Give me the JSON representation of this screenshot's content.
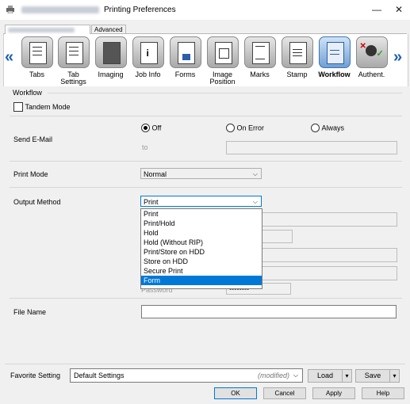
{
  "window": {
    "title": "Printing Preferences",
    "minimize_icon": "minimize-icon",
    "close_icon": "close-icon"
  },
  "main_tabs": [
    {
      "label": "",
      "active": true
    },
    {
      "label": "Advanced",
      "active": false
    }
  ],
  "toolbar": {
    "left_arrow": "«",
    "right_arrow": "»",
    "items": [
      {
        "label": "Tabs",
        "icon": "tabs-icon"
      },
      {
        "label": "Tab\nSettings",
        "icon": "tab-settings-icon"
      },
      {
        "label": "Imaging",
        "icon": "imaging-icon"
      },
      {
        "label": "Job Info",
        "icon": "job-info-icon"
      },
      {
        "label": "Forms",
        "icon": "forms-icon"
      },
      {
        "label": "Image\nPosition",
        "icon": "image-position-icon"
      },
      {
        "label": "Marks",
        "icon": "marks-icon"
      },
      {
        "label": "Stamp",
        "icon": "stamp-icon"
      },
      {
        "label": "Workflow",
        "icon": "workflow-icon",
        "active": true
      },
      {
        "label": "Authent.",
        "icon": "authentication-icon"
      }
    ]
  },
  "workflow": {
    "section_title": "Workflow",
    "tandem_mode": {
      "label": "Tandem Mode",
      "checked": false
    },
    "send_email": {
      "label": "Send E-Mail",
      "options": [
        {
          "label": "Off",
          "selected": true
        },
        {
          "label": "On Error",
          "selected": false
        },
        {
          "label": "Always",
          "selected": false
        }
      ],
      "to_label": "to",
      "to_value": ""
    },
    "print_mode": {
      "label": "Print Mode",
      "value": "Normal"
    },
    "output_method": {
      "label": "Output Method",
      "value": "Print",
      "options": [
        "Print",
        "Print/Hold",
        "Hold",
        "Hold (Without RIP)",
        "Print/Store on HDD",
        "Store on HDD",
        "Secure Print",
        "Form"
      ],
      "highlighted": "Form"
    },
    "password": {
      "label": "Password",
      "value": "••••••••"
    },
    "file_name": {
      "label": "File Name",
      "value": ""
    }
  },
  "footer": {
    "favorite_label": "Favorite Setting",
    "favorite_value": "Default Settings",
    "modified_text": "(modified)",
    "load_label": "Load",
    "save_label": "Save",
    "ok_label": "OK",
    "cancel_label": "Cancel",
    "apply_label": "Apply",
    "help_label": "Help"
  }
}
